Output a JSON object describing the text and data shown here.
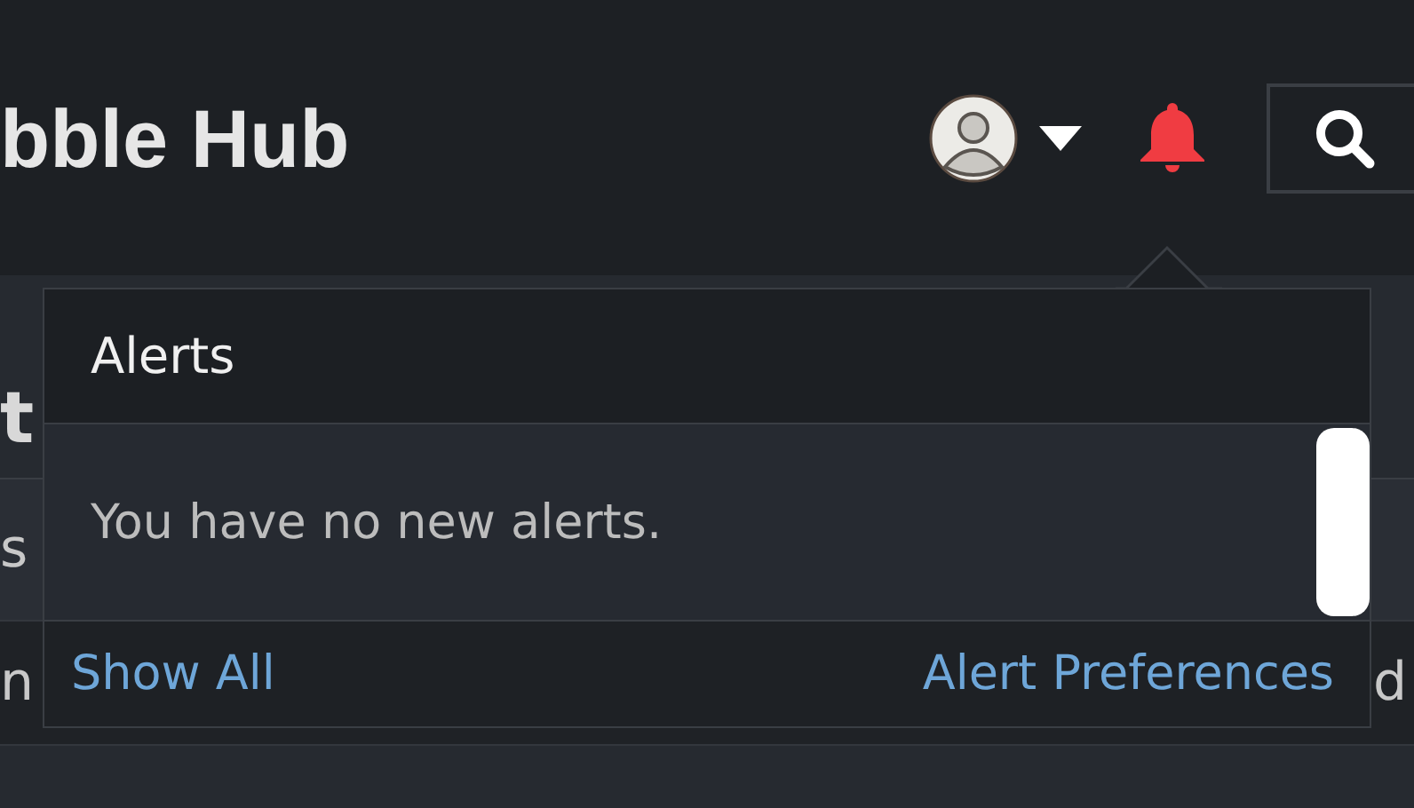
{
  "header": {
    "title": "bble Hub"
  },
  "page": {
    "heading": "t",
    "rows": [
      {
        "left": "s"
      },
      {
        "left": "n",
        "right": "d"
      }
    ]
  },
  "alerts_popup": {
    "title": "Alerts",
    "empty_message": "You have no new alerts.",
    "links": [
      "Show All",
      "Alert Preferences"
    ]
  }
}
